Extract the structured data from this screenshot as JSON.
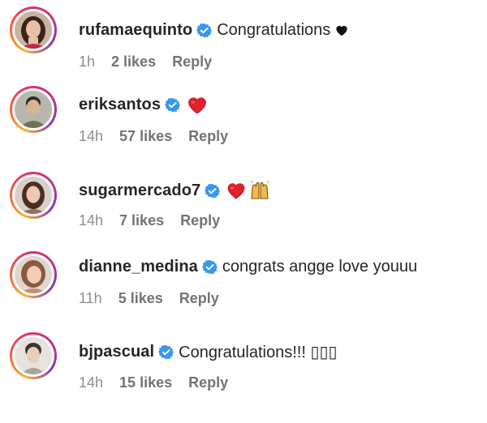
{
  "comments": [
    {
      "username": "rufamaequinto",
      "text": "Congratulations",
      "emoji": [
        "black-heart"
      ],
      "time": "1h",
      "likes": "2 likes",
      "reply": "Reply",
      "avatar_colors": {
        "bg": "#c9b3a0",
        "hair": "#3a2319",
        "face": "#e9c1a6",
        "accent": "#c0294a"
      }
    },
    {
      "username": "eriksantos",
      "text": "",
      "emoji": [
        "red-heart"
      ],
      "time": "14h",
      "likes": "57 likes",
      "reply": "Reply",
      "avatar_colors": {
        "bg": "#b9b7ad",
        "hair": "#2b2b2b",
        "face": "#d8b494",
        "accent": "#6e7356"
      }
    },
    {
      "username": "sugarmercado7",
      "text": "",
      "emoji": [
        "red-heart",
        "raising-hands"
      ],
      "time": "14h",
      "likes": "7 likes",
      "reply": "Reply",
      "avatar_colors": {
        "bg": "#d9cfc7",
        "hair": "#4a2f25",
        "face": "#edc9b3",
        "accent": "#9a6e5e"
      }
    },
    {
      "username": "dianne_medina",
      "text": "congrats angge love youuu",
      "emoji": [],
      "time": "11h",
      "likes": "5 likes",
      "reply": "Reply",
      "avatar_colors": {
        "bg": "#e0d6cf",
        "hair": "#8a5a3a",
        "face": "#f0cdb4",
        "accent": "#c78c6a"
      }
    },
    {
      "username": "bjpascual",
      "text": "Congratulations!!! ▯▯▯",
      "emoji": [],
      "time": "14h",
      "likes": "15 likes",
      "reply": "Reply",
      "avatar_colors": {
        "bg": "#e6e3df",
        "hair": "#3b3633",
        "face": "#e8cdb8",
        "accent": "#a9a39c"
      }
    }
  ],
  "colors": {
    "verified_badge": "#3897f0",
    "meta_text": "#8e8e8e",
    "heart_red": "#e0202b",
    "heart_black": "#111111"
  }
}
